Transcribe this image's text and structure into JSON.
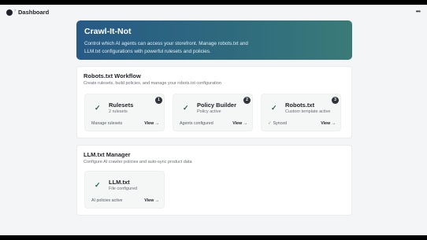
{
  "header": {
    "breadcrumb_separator": "›",
    "title": "Dashboard",
    "more_icon": "more-horizontal-icon"
  },
  "hero": {
    "title": "Crawl-It-Not",
    "description": "Control which AI agents can access your storefront. Manage robots.txt and LLM.txt configurations with powerful rulesets and policies."
  },
  "workflow": {
    "title": "Robots.txt Workflow",
    "subtitle": "Create rulesets, build policies, and manage your robots.txt configuration",
    "cards": [
      {
        "step": "1",
        "title": "Rulesets",
        "subtitle": "2 rulesets",
        "footer": "Manage rulesets",
        "link": "View →"
      },
      {
        "step": "2",
        "title": "Policy Builder",
        "subtitle": "Policy active",
        "footer": "Agents configured",
        "link": "View →"
      },
      {
        "step": "3",
        "title": "Robots.txt",
        "subtitle": "Custom template active",
        "footer_check": "✓",
        "footer": "Synced",
        "link": "View →"
      }
    ]
  },
  "llm": {
    "title": "LLM.txt Manager",
    "subtitle": "Configure AI crawler policies and auto-sync product data",
    "card": {
      "title": "LLM.txt",
      "subtitle": "File configured",
      "footer": "AI policies active",
      "link": "View →"
    }
  },
  "icons": {
    "check": "✓",
    "status_icon": "check-icon"
  },
  "colors": {
    "accent": "#2e5f4e",
    "hero_start": "#275a86",
    "hero_end": "#3a7b78",
    "badge": "#2f3338"
  }
}
